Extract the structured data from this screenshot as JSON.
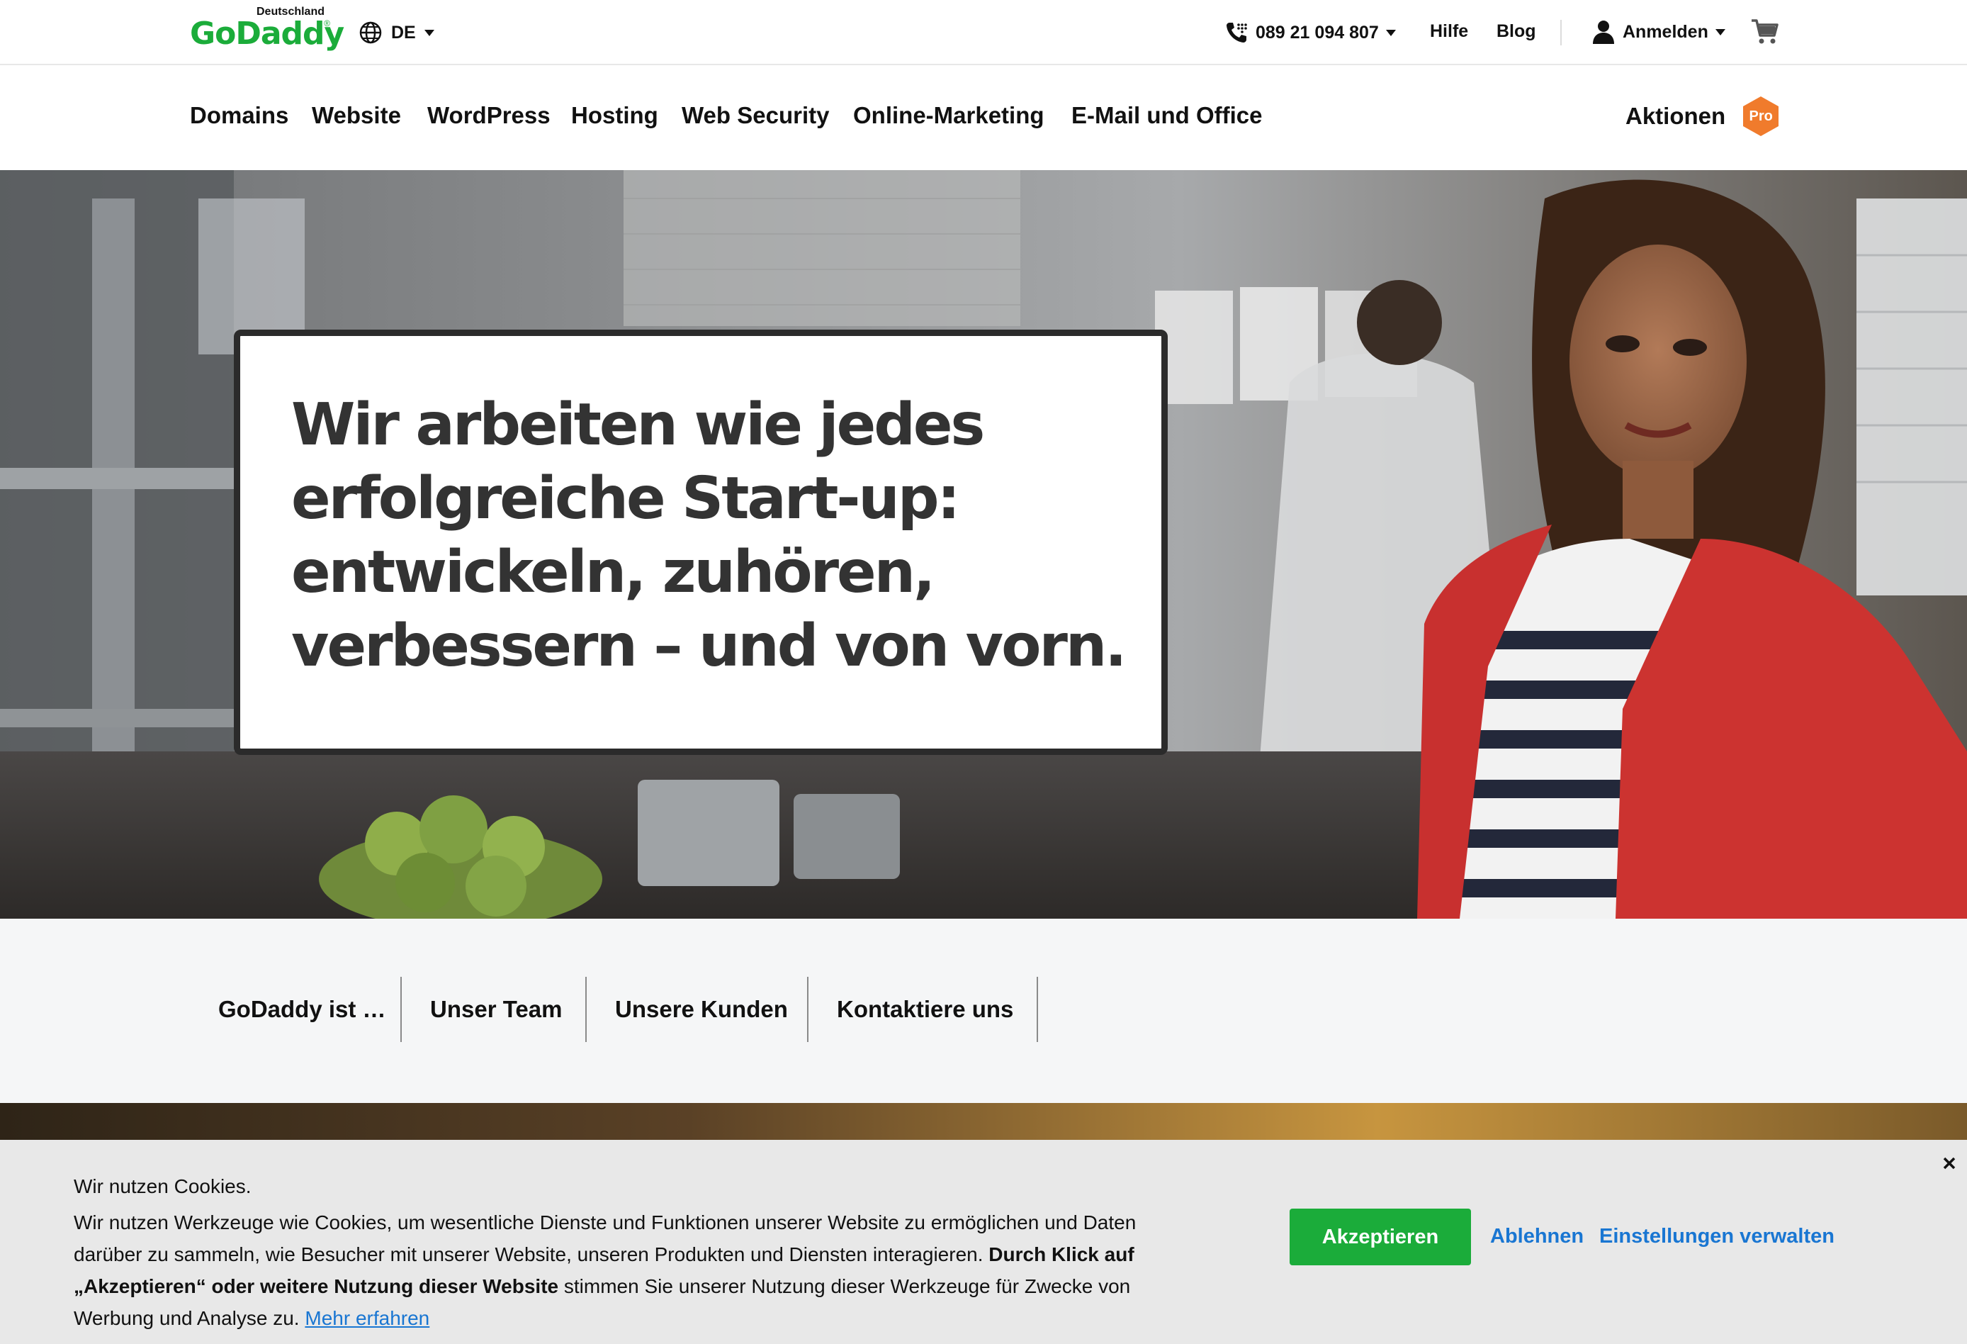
{
  "header": {
    "logo_region": "Deutschland",
    "logo_word": "GoDaddy",
    "logo_reg": "®",
    "language": "DE",
    "phone": "089 21 094 807",
    "help": "Hilfe",
    "blog": "Blog",
    "signin": "Anmelden"
  },
  "nav": {
    "items": [
      "Domains",
      "Website",
      "WordPress",
      "Hosting",
      "Web Security",
      "Online-Marketing",
      "E-Mail und Office"
    ],
    "promo_label": "Aktionen",
    "promo_badge": "Pro"
  },
  "hero": {
    "headline": "Wir arbeiten wie jedes erfolgreiche Start-up: entwickeln, zuhören, verbessern – und von vorn."
  },
  "tabs": [
    "GoDaddy ist …",
    "Unser Team",
    "Unsere Kunden",
    "Kontaktiere uns"
  ],
  "cookie": {
    "title": "Wir nutzen Cookies.",
    "text1": "Wir nutzen Werkzeuge wie Cookies, um wesentliche Dienste und Funktionen unserer Website zu ermöglichen und Daten darüber zu sammeln, wie Besucher mit unserer Website, unseren Produkten und Diensten interagieren. ",
    "bold": "Durch Klick auf „Akzeptieren“ oder weitere Nutzung dieser Website",
    "text2": " stimmen Sie unserer Nutzung dieser Werkzeuge für Zwecke von Werbung und Analyse zu. ",
    "learn_more": "Mehr erfahren",
    "accept": "Akzeptieren",
    "decline": "Ablehnen",
    "settings": "Einstellungen verwalten"
  },
  "colors": {
    "brand_green": "#1bac3a",
    "link_blue": "#1976d2",
    "promo_orange": "#f07b2c"
  },
  "icons": [
    "globe-icon",
    "phone-icon",
    "user-icon",
    "cart-icon",
    "close-icon"
  ]
}
